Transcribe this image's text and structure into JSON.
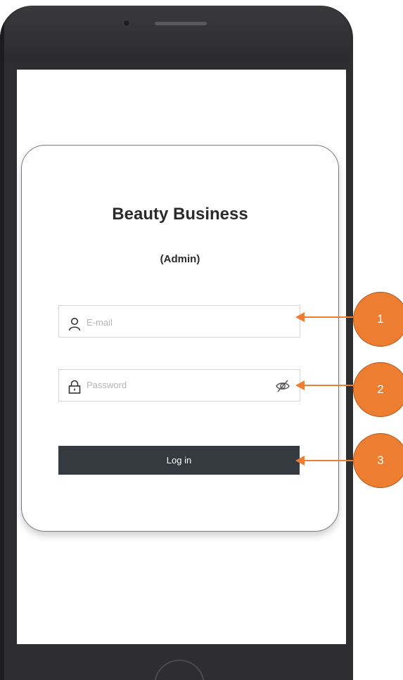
{
  "app": {
    "title": "Beauty Business",
    "subtitle": "(Admin)"
  },
  "form": {
    "email_placeholder": "E-mail",
    "password_placeholder": "Password",
    "login_label": "Log in"
  },
  "annotations": [
    {
      "label": "1",
      "target": "email-field"
    },
    {
      "label": "2",
      "target": "password-visibility-toggle"
    },
    {
      "label": "3",
      "target": "login-button"
    }
  ],
  "colors": {
    "accent": "#ed7d31",
    "button": "#343a40",
    "phone": "#2e2e30"
  }
}
